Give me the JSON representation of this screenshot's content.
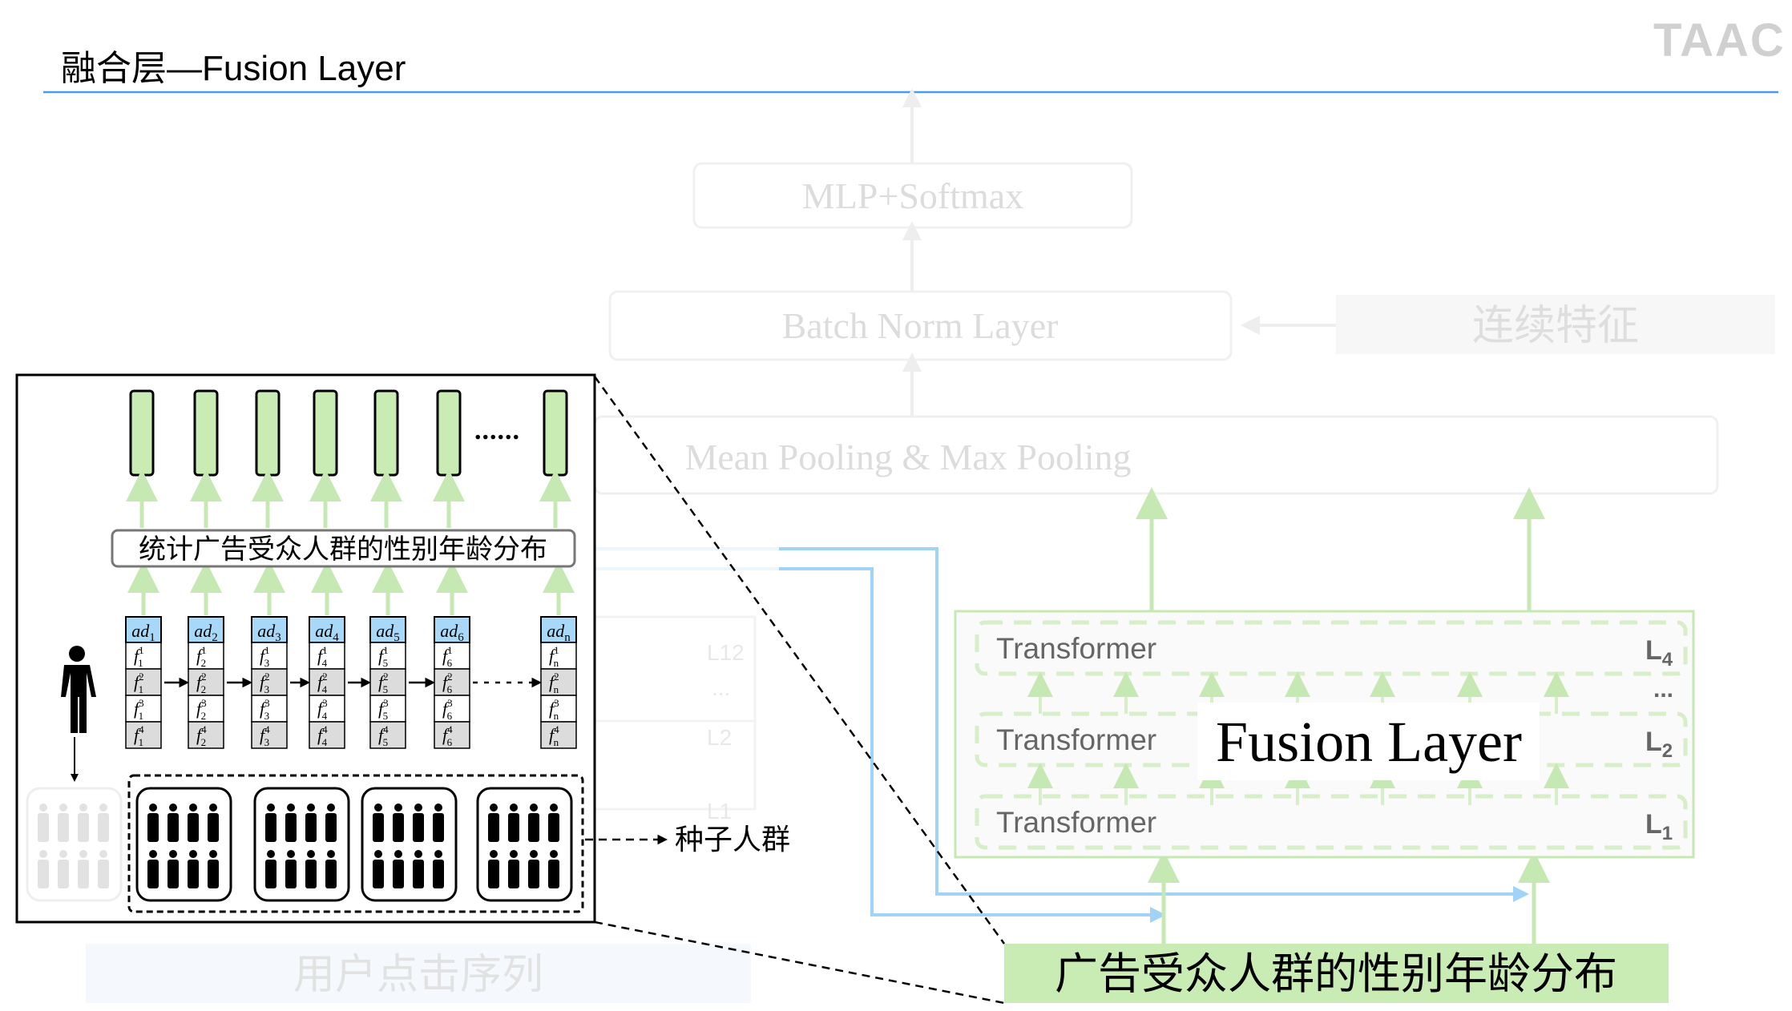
{
  "header": {
    "title": "融合层—Fusion Layer",
    "logo_text": "TAAC"
  },
  "colors": {
    "accent_line": "#4a9ee8",
    "green_fill": "#c9ecb4",
    "green_arrow": "#c6e9b3",
    "blue_header": "#a8d8f8",
    "blue_line": "#9fd3f7",
    "faded_text": "#dcdcdc"
  },
  "model": {
    "mlp": "MLP+Softmax",
    "batch_norm": "Batch Norm Layer",
    "continuous_features": "连续特征",
    "pooling": "Mean Pooling & Max Pooling",
    "user_click_sequence": "用户点击序列",
    "ad_audience_distribution": "广告受众人群的性别年龄分布",
    "fusion_label": "Fusion Layer",
    "transformers": [
      {
        "label": "Transformer",
        "layer": "L",
        "sub": "4"
      },
      {
        "label": "Transformer",
        "layer": "L",
        "sub": "2"
      },
      {
        "label": "Transformer",
        "layer": "L",
        "sub": "1"
      }
    ],
    "ellipsis": "...",
    "ghost_layers": [
      "L12",
      "...",
      "L2",
      "L1"
    ]
  },
  "inset": {
    "stats_label": "统计广告受众人群的性别年龄分布",
    "ellipsis": "......",
    "ad_prefix": "ad",
    "feature_prefix": "f",
    "columns": [
      "1",
      "2",
      "3",
      "4",
      "5",
      "6",
      "n"
    ],
    "feature_rows": [
      "1",
      "2",
      "3",
      "4"
    ],
    "seed_label": "种子人群",
    "icons": {
      "user": "person-icon",
      "group": "people-group-icon"
    }
  }
}
